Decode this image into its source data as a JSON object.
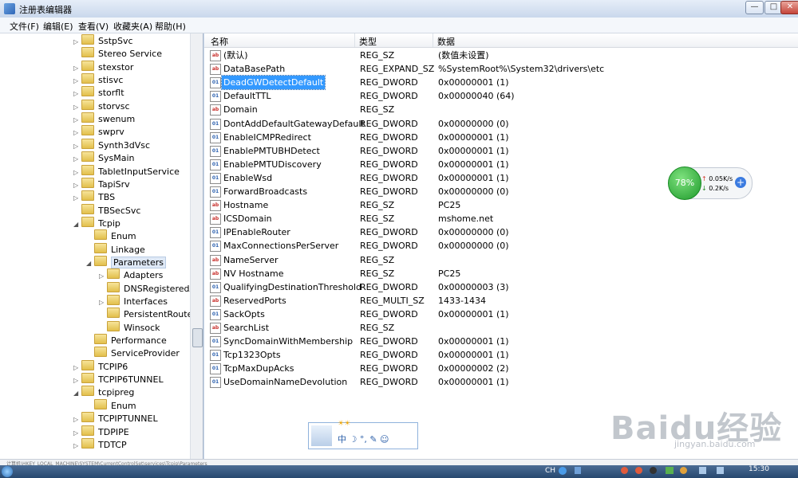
{
  "window": {
    "title": "注册表编辑器",
    "controls": {
      "minimize": "—",
      "maximize": "□",
      "close": "✕"
    }
  },
  "menu": [
    "文件(F)",
    "编辑(E)",
    "查看(V)",
    "收藏夹(A)",
    "帮助(H)"
  ],
  "tree": [
    {
      "label": "SstpSvc",
      "arrow": "▷"
    },
    {
      "label": "Stereo Service",
      "arrow": ""
    },
    {
      "label": "stexstor",
      "arrow": "▷"
    },
    {
      "label": "stisvc",
      "arrow": "▷"
    },
    {
      "label": "storflt",
      "arrow": "▷"
    },
    {
      "label": "storvsc",
      "arrow": "▷"
    },
    {
      "label": "swenum",
      "arrow": "▷"
    },
    {
      "label": "swprv",
      "arrow": "▷"
    },
    {
      "label": "Synth3dVsc",
      "arrow": "▷"
    },
    {
      "label": "SysMain",
      "arrow": "▷"
    },
    {
      "label": "TabletInputService",
      "arrow": "▷"
    },
    {
      "label": "TapiSrv",
      "arrow": "▷"
    },
    {
      "label": "TBS",
      "arrow": "▷"
    },
    {
      "label": "TBSecSvc",
      "arrow": ""
    },
    {
      "label": "Tcpip",
      "arrow": "◢"
    },
    {
      "label": "Enum",
      "arrow": ""
    },
    {
      "label": "Linkage",
      "arrow": ""
    },
    {
      "label": "Parameters",
      "arrow": "◢"
    },
    {
      "label": "Adapters",
      "arrow": "▷"
    },
    {
      "label": "DNSRegisteredAda",
      "arrow": ""
    },
    {
      "label": "Interfaces",
      "arrow": "▷"
    },
    {
      "label": "PersistentRoutes",
      "arrow": ""
    },
    {
      "label": "Winsock",
      "arrow": ""
    },
    {
      "label": "Performance",
      "arrow": ""
    },
    {
      "label": "ServiceProvider",
      "arrow": ""
    },
    {
      "label": "TCPIP6",
      "arrow": "▷"
    },
    {
      "label": "TCPIP6TUNNEL",
      "arrow": "▷"
    },
    {
      "label": "tcpipreg",
      "arrow": "◢"
    },
    {
      "label": "Enum",
      "arrow": ""
    },
    {
      "label": "TCPIPTUNNEL",
      "arrow": "▷"
    },
    {
      "label": "TDPIPE",
      "arrow": "▷"
    },
    {
      "label": "TDTCP",
      "arrow": "▷"
    }
  ],
  "list": {
    "headers": {
      "name": "名称",
      "type": "类型",
      "data": "数据"
    },
    "rows": [
      {
        "icon": "ab",
        "name": "(默认)",
        "type": "REG_SZ",
        "data": "(数值未设置)"
      },
      {
        "icon": "ab",
        "name": "DataBasePath",
        "type": "REG_EXPAND_SZ",
        "data": "%SystemRoot%\\System32\\drivers\\etc"
      },
      {
        "icon": "01",
        "name": "DeadGWDetectDefault",
        "type": "REG_DWORD",
        "data": "0x00000001 (1)"
      },
      {
        "icon": "01",
        "name": "DefaultTTL",
        "type": "REG_DWORD",
        "data": "0x00000040 (64)"
      },
      {
        "icon": "ab",
        "name": "Domain",
        "type": "REG_SZ",
        "data": ""
      },
      {
        "icon": "01",
        "name": "DontAddDefaultGatewayDefault",
        "type": "REG_DWORD",
        "data": "0x00000000 (0)"
      },
      {
        "icon": "01",
        "name": "EnableICMPRedirect",
        "type": "REG_DWORD",
        "data": "0x00000001 (1)"
      },
      {
        "icon": "01",
        "name": "EnablePMTUBHDetect",
        "type": "REG_DWORD",
        "data": "0x00000001 (1)"
      },
      {
        "icon": "01",
        "name": "EnablePMTUDiscovery",
        "type": "REG_DWORD",
        "data": "0x00000001 (1)"
      },
      {
        "icon": "01",
        "name": "EnableWsd",
        "type": "REG_DWORD",
        "data": "0x00000001 (1)"
      },
      {
        "icon": "01",
        "name": "ForwardBroadcasts",
        "type": "REG_DWORD",
        "data": "0x00000000 (0)"
      },
      {
        "icon": "ab",
        "name": "Hostname",
        "type": "REG_SZ",
        "data": "PC25"
      },
      {
        "icon": "ab",
        "name": "ICSDomain",
        "type": "REG_SZ",
        "data": "mshome.net"
      },
      {
        "icon": "01",
        "name": "IPEnableRouter",
        "type": "REG_DWORD",
        "data": "0x00000000 (0)"
      },
      {
        "icon": "01",
        "name": "MaxConnectionsPerServer",
        "type": "REG_DWORD",
        "data": "0x00000000 (0)"
      },
      {
        "icon": "ab",
        "name": "NameServer",
        "type": "REG_SZ",
        "data": ""
      },
      {
        "icon": "ab",
        "name": "NV Hostname",
        "type": "REG_SZ",
        "data": "PC25"
      },
      {
        "icon": "01",
        "name": "QualifyingDestinationThreshold",
        "type": "REG_DWORD",
        "data": "0x00000003 (3)"
      },
      {
        "icon": "ab",
        "name": "ReservedPorts",
        "type": "REG_MULTI_SZ",
        "data": "1433-1434"
      },
      {
        "icon": "01",
        "name": "SackOpts",
        "type": "REG_DWORD",
        "data": "0x00000001 (1)"
      },
      {
        "icon": "ab",
        "name": "SearchList",
        "type": "REG_SZ",
        "data": ""
      },
      {
        "icon": "01",
        "name": "SyncDomainWithMembership",
        "type": "REG_DWORD",
        "data": "0x00000001 (1)"
      },
      {
        "icon": "01",
        "name": "Tcp1323Opts",
        "type": "REG_DWORD",
        "data": "0x00000001 (1)"
      },
      {
        "icon": "01",
        "name": "TcpMaxDupAcks",
        "type": "REG_DWORD",
        "data": "0x00000002 (2)"
      },
      {
        "icon": "01",
        "name": "UseDomainNameDevolution",
        "type": "REG_DWORD",
        "data": "0x00000001 (1)"
      }
    ]
  },
  "net_widget": {
    "percent": "78%",
    "upload": "0.05K/s",
    "download": "0.2K/s",
    "up_arrow": "↑",
    "down_arrow": "↓",
    "plus": "+"
  },
  "ime": {
    "suns": "☀☀",
    "tools": "中 ☽ °, ✎ ☺"
  },
  "statusbar": {
    "path": "计算机\\HKEY_LOCAL_MACHINE\\SYSTEM\\CurrentControlSet\\services\\Tcpip\\Parameters"
  },
  "taskbar": {
    "lang": "CH",
    "time": "15:30"
  },
  "watermark": {
    "logo": "Baidu经验",
    "url": "jingyan.baidu.com"
  }
}
